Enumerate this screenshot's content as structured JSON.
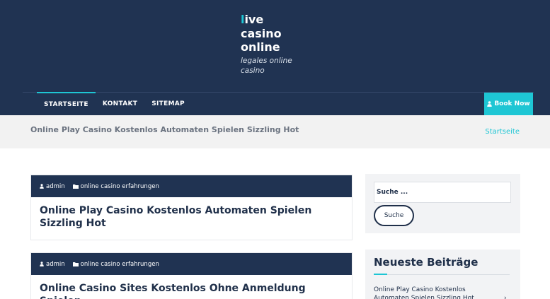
{
  "site": {
    "logo_first_letter": "l",
    "logo_rest_line1": "ive",
    "logo_line2": "casino",
    "logo_line3": "online",
    "tagline_line1": "legales online",
    "tagline_line2": "casino"
  },
  "nav": {
    "items": [
      {
        "label": "STARTSEITE",
        "active": true
      },
      {
        "label": "KONTAKT",
        "active": false
      },
      {
        "label": "SITEMAP",
        "active": false
      }
    ],
    "book_now": "Book Now",
    "book_icon": "user-icon"
  },
  "breadcrumb": {
    "page_title": "Online Play Casino Kostenlos Automaten Spielen Sizzling Hot",
    "crumb": "Startseite"
  },
  "posts": [
    {
      "author": "admin",
      "category": "online casino erfahrungen",
      "title": "Online Play Casino Kostenlos Automaten Spielen Sizzling Hot"
    },
    {
      "author": "admin",
      "category": "online casino erfahrungen",
      "title": "Online Casino Sites Kostenlos Ohne Anmeldung Spielen"
    }
  ],
  "sidebar": {
    "search_placeholder": "Suche ...",
    "search_button": "Suche",
    "recent_heading": "Neueste Beiträge",
    "recent_items": [
      "Online Play Casino Kostenlos Automaten Spielen Sizzling Hot"
    ]
  },
  "colors": {
    "header_bg": "#203352",
    "accent": "#1ec6d4",
    "breadcrumb_bg": "#f2f2f2"
  }
}
